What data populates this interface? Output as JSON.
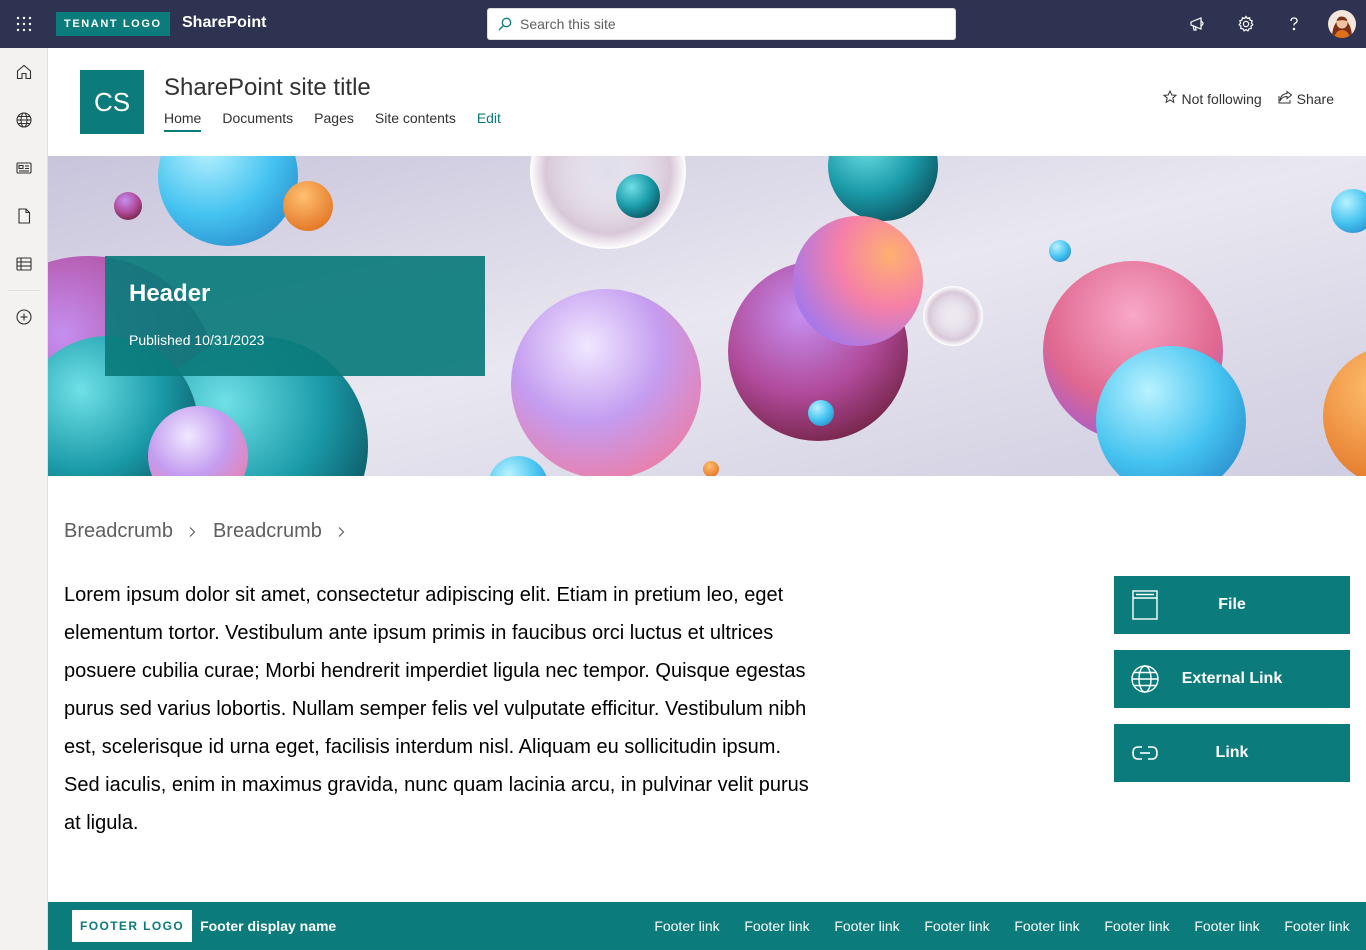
{
  "suite_bar": {
    "tenant_logo": "TENANT LOGO",
    "app_name": "SharePoint",
    "search_placeholder": "Search this site",
    "icons": [
      "waffle-icon",
      "megaphone-icon",
      "settings-icon",
      "help-icon",
      "avatar"
    ]
  },
  "left_rail": {
    "items": [
      "home-icon",
      "globe-icon",
      "news-icon",
      "file-icon",
      "list-icon",
      "add-icon"
    ]
  },
  "site_header": {
    "logo_initials": "CS",
    "title": "SharePoint site title",
    "nav": [
      {
        "label": "Home",
        "active": true
      },
      {
        "label": "Documents",
        "active": false
      },
      {
        "label": "Pages",
        "active": false
      },
      {
        "label": "Site contents",
        "active": false
      },
      {
        "label": "Edit",
        "active": false
      }
    ],
    "follow_label": "Not following",
    "share_label": "Share"
  },
  "hero": {
    "title": "Header",
    "published": "Published 10/31/2023"
  },
  "breadcrumb": [
    "Breadcrumb",
    "Breadcrumb"
  ],
  "body_text": "Lorem ipsum dolor sit amet, consectetur adipiscing elit. Etiam in pretium leo, eget elementum tortor. Vestibulum ante ipsum primis in faucibus orci luctus et ultrices posuere cubilia curae; Morbi hendrerit imperdiet ligula nec tempor. Quisque egestas purus sed varius lobortis. Nullam semper felis vel vulputate efficitur. Vestibulum nibh est, scelerisque id urna eget, facilisis interdum nisl. Aliquam eu sollicitudin ipsum. Sed iaculis, enim in maximus gravida, nunc quam lacinia arcu, in pulvinar velit purus at ligula.",
  "quick_links": [
    {
      "label": "File",
      "icon": "file-icon"
    },
    {
      "label": "External Link",
      "icon": "globe-icon"
    },
    {
      "label": "Link",
      "icon": "link-icon"
    }
  ],
  "footer": {
    "logo": "FOOTER LOGO",
    "display_name": "Footer display name",
    "links": [
      "Footer link",
      "Footer link",
      "Footer link",
      "Footer link",
      "Footer link",
      "Footer link",
      "Footer link",
      "Footer link"
    ]
  },
  "colors": {
    "suite_bar": "#2d3350",
    "theme_primary": "#0b7b7b"
  }
}
